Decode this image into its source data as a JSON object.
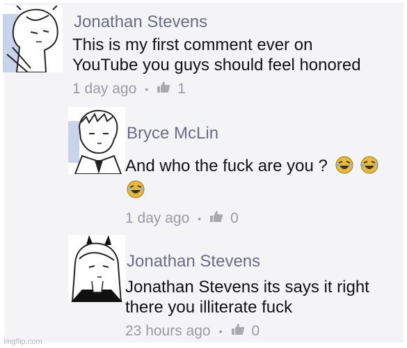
{
  "comments": [
    {
      "author": "Jonathan Stevens",
      "lines": [
        "This is my first comment ever on",
        "YouTube you guys should feel honored"
      ],
      "time": "1 day ago",
      "likes": "1"
    },
    {
      "author": "Bryce McLin",
      "lines": [
        "And who the fuck are you ?"
      ],
      "time": "1 day ago",
      "likes": "0"
    },
    {
      "author": "Jonathan Stevens",
      "lines": [
        "Jonathan Stevens its says it right",
        "there you illiterate fuck"
      ],
      "time": "23 hours ago",
      "likes": "0"
    }
  ],
  "footer": {
    "imgflip": "imgflip.com"
  },
  "icons": {
    "like": "thumbs-up-icon",
    "laugh": "laughing-emoji-icon"
  }
}
